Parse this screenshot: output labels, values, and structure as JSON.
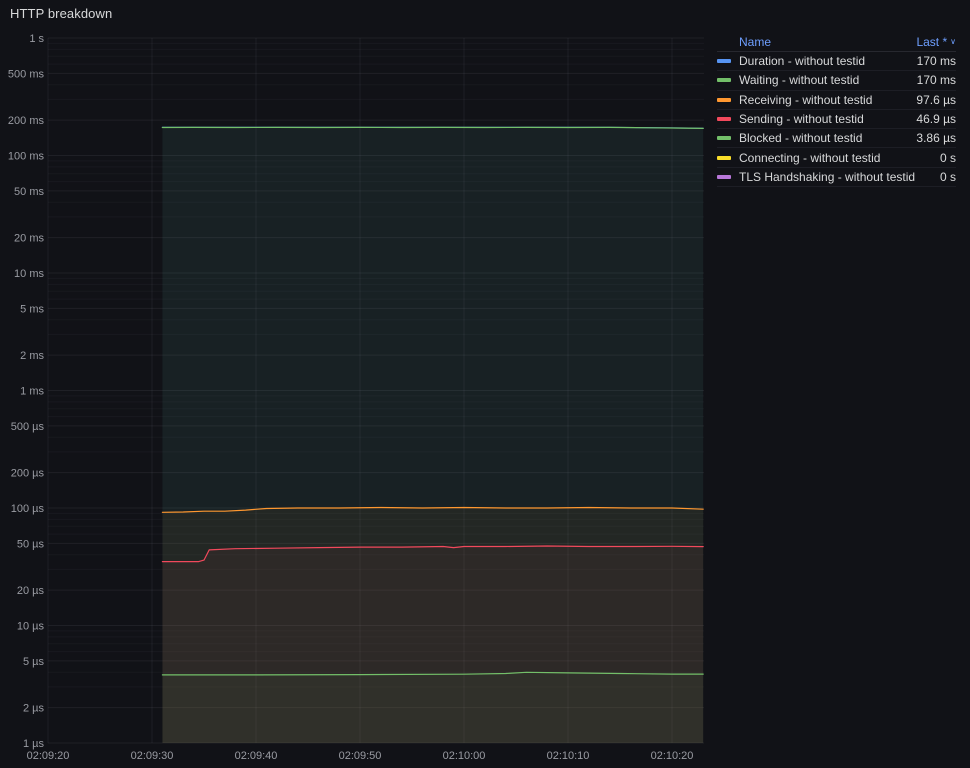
{
  "panel": {
    "title": "HTTP breakdown"
  },
  "colors": {
    "background": "#111217",
    "text": "#d8d9da",
    "text_secondary": "#9a9ca3",
    "link": "#6e9fff",
    "grid": "#ccccdc"
  },
  "legend": {
    "name_header": "Name",
    "value_header": "Last *",
    "sort_icon": "∨",
    "rows": [
      {
        "label": "Duration - without testid",
        "value": "170 ms",
        "color": "#5794F2"
      },
      {
        "label": "Waiting - without testid",
        "value": "170 ms",
        "color": "#73BF69"
      },
      {
        "label": "Receiving - without testid",
        "value": "97.6 µs",
        "color": "#FF9830"
      },
      {
        "label": "Sending - without testid",
        "value": "46.9 µs",
        "color": "#F2495C"
      },
      {
        "label": "Blocked - without testid",
        "value": "3.86 µs",
        "color": "#73BF69"
      },
      {
        "label": "Connecting - without testid",
        "value": "0 s",
        "color": "#FADE2A"
      },
      {
        "label": "TLS Handshaking - without testid",
        "value": "0 s",
        "color": "#B877D9"
      }
    ]
  },
  "chart_data": {
    "type": "line",
    "title": "HTTP breakdown",
    "y_scale": "log10",
    "y_unit": "seconds",
    "ylim": [
      1e-06,
      1
    ],
    "grid": true,
    "legend_position": "right-table",
    "x_axis_times": [
      "02:09:20",
      "02:09:30",
      "02:09:40",
      "02:09:50",
      "02:10:00",
      "02:10:10",
      "02:10:20"
    ],
    "y_ticks": [
      {
        "label": "1 s",
        "value": 1
      },
      {
        "label": "500 ms",
        "value": 0.5
      },
      {
        "label": "200 ms",
        "value": 0.2
      },
      {
        "label": "100 ms",
        "value": 0.1
      },
      {
        "label": "50 ms",
        "value": 0.05
      },
      {
        "label": "20 ms",
        "value": 0.02
      },
      {
        "label": "10 ms",
        "value": 0.01
      },
      {
        "label": "5 ms",
        "value": 0.005
      },
      {
        "label": "2 ms",
        "value": 0.002
      },
      {
        "label": "1 ms",
        "value": 0.001
      },
      {
        "label": "500 µs",
        "value": 0.0005
      },
      {
        "label": "200 µs",
        "value": 0.0002
      },
      {
        "label": "100 µs",
        "value": 0.0001
      },
      {
        "label": "50 µs",
        "value": 5e-05
      },
      {
        "label": "20 µs",
        "value": 2e-05
      },
      {
        "label": "10 µs",
        "value": 1e-05
      },
      {
        "label": "5 µs",
        "value": 5e-06
      },
      {
        "label": "2 µs",
        "value": 2e-06
      },
      {
        "label": "1 µs",
        "value": 1e-06
      }
    ],
    "x_ticks": [
      {
        "label": "02:09:20",
        "t": 0
      },
      {
        "label": "02:09:30",
        "t": 10
      },
      {
        "label": "02:09:40",
        "t": 20
      },
      {
        "label": "02:09:50",
        "t": 30
      },
      {
        "label": "02:10:00",
        "t": 40
      },
      {
        "label": "02:10:10",
        "t": 50
      },
      {
        "label": "02:10:20",
        "t": 60
      }
    ],
    "x_seconds_from": "02:09:20",
    "series": [
      {
        "name": "Duration - without testid",
        "color": "#5794F2",
        "last": "170 ms",
        "fill_opacity": 0.05,
        "points": [
          [
            11,
            0.1733
          ],
          [
            14,
            0.1738
          ],
          [
            18,
            0.1733
          ],
          [
            22,
            0.1738
          ],
          [
            26,
            0.1733
          ],
          [
            30,
            0.1738
          ],
          [
            34,
            0.1733
          ],
          [
            38,
            0.1738
          ],
          [
            42,
            0.1733
          ],
          [
            46,
            0.1738
          ],
          [
            50,
            0.1733
          ],
          [
            54,
            0.1738
          ],
          [
            58,
            0.1723
          ],
          [
            61,
            0.1713
          ],
          [
            63,
            0.1703
          ]
        ]
      },
      {
        "name": "Waiting - without testid",
        "color": "#73BF69",
        "last": "170 ms",
        "fill_opacity": 0.05,
        "points": [
          [
            11,
            0.173
          ],
          [
            14,
            0.1735
          ],
          [
            18,
            0.173
          ],
          [
            22,
            0.1735
          ],
          [
            26,
            0.173
          ],
          [
            30,
            0.1735
          ],
          [
            34,
            0.173
          ],
          [
            38,
            0.1735
          ],
          [
            42,
            0.173
          ],
          [
            46,
            0.1735
          ],
          [
            50,
            0.173
          ],
          [
            54,
            0.1735
          ],
          [
            58,
            0.172
          ],
          [
            61,
            0.171
          ],
          [
            63,
            0.17
          ]
        ]
      },
      {
        "name": "Receiving - without testid",
        "color": "#FF9830",
        "last": "97.6 µs",
        "fill_opacity": 0.05,
        "points": [
          [
            11,
            9.2e-05
          ],
          [
            13,
            9.25e-05
          ],
          [
            15,
            9.4e-05
          ],
          [
            17,
            9.4e-05
          ],
          [
            19,
            9.6e-05
          ],
          [
            21,
            9.9e-05
          ],
          [
            24,
            0.0001
          ],
          [
            28,
            0.0001
          ],
          [
            32,
            0.000101
          ],
          [
            36,
            0.0001
          ],
          [
            40,
            0.000101
          ],
          [
            44,
            0.0001
          ],
          [
            48,
            0.0001
          ],
          [
            52,
            0.000101
          ],
          [
            56,
            0.0001
          ],
          [
            60,
            0.0001
          ],
          [
            63,
            9.76e-05
          ]
        ]
      },
      {
        "name": "Sending - without testid",
        "color": "#F2495C",
        "last": "46.9 µs",
        "fill_opacity": 0.05,
        "points": [
          [
            11,
            3.5e-05
          ],
          [
            14.5,
            3.5e-05
          ],
          [
            15,
            3.6e-05
          ],
          [
            15.5,
            4.4e-05
          ],
          [
            18,
            4.5e-05
          ],
          [
            22,
            4.55e-05
          ],
          [
            26,
            4.6e-05
          ],
          [
            30,
            4.65e-05
          ],
          [
            34,
            4.65e-05
          ],
          [
            38,
            4.7e-05
          ],
          [
            39,
            4.6e-05
          ],
          [
            40,
            4.7e-05
          ],
          [
            44,
            4.7e-05
          ],
          [
            48,
            4.75e-05
          ],
          [
            52,
            4.7e-05
          ],
          [
            56,
            4.7e-05
          ],
          [
            60,
            4.72e-05
          ],
          [
            63,
            4.69e-05
          ]
        ]
      },
      {
        "name": "Blocked - without testid",
        "color": "#73BF69",
        "last": "3.86 µs",
        "fill_opacity": 0.05,
        "points": [
          [
            11,
            3.8e-06
          ],
          [
            20,
            3.8e-06
          ],
          [
            30,
            3.82e-06
          ],
          [
            40,
            3.85e-06
          ],
          [
            44,
            3.9e-06
          ],
          [
            46,
            4e-06
          ],
          [
            50,
            3.95e-06
          ],
          [
            55,
            3.9e-06
          ],
          [
            60,
            3.86e-06
          ],
          [
            63,
            3.86e-06
          ]
        ]
      },
      {
        "name": "Connecting - without testid",
        "color": "#FADE2A",
        "last": "0 s",
        "fill_opacity": 0.05,
        "points": []
      },
      {
        "name": "TLS Handshaking - without testid",
        "color": "#B877D9",
        "last": "0 s",
        "fill_opacity": 0.05,
        "points": []
      }
    ]
  }
}
